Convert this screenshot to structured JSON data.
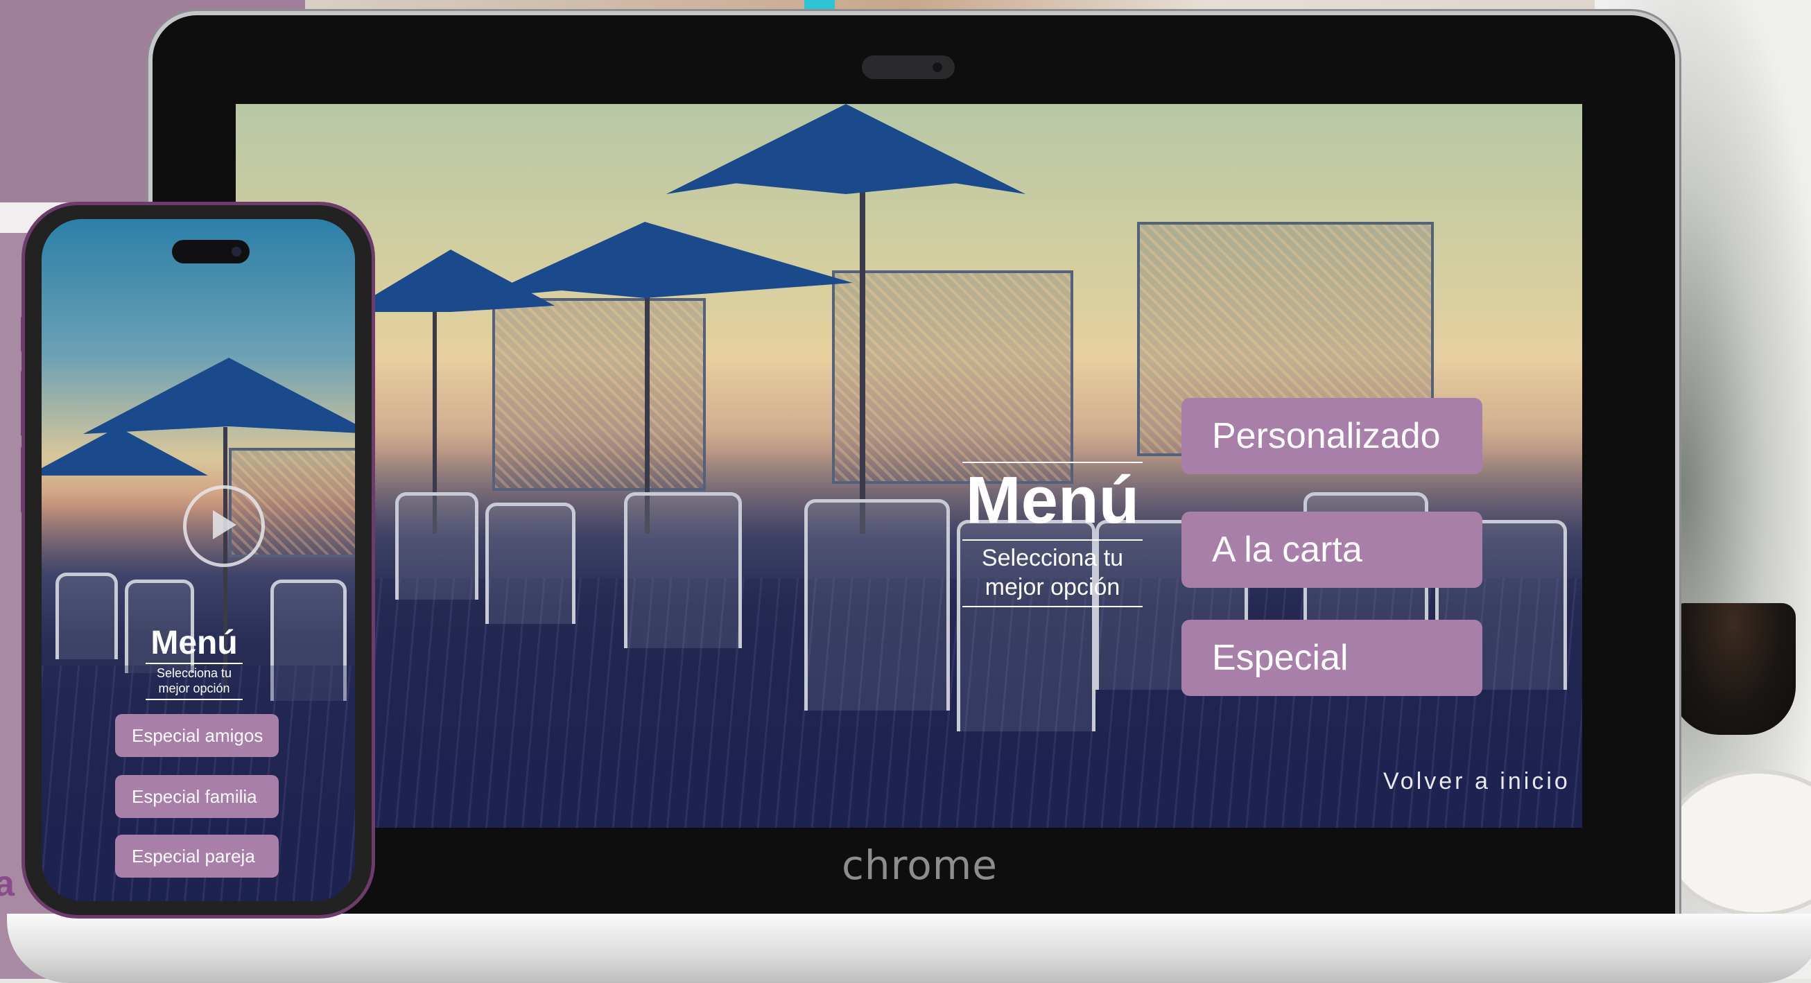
{
  "laptop": {
    "brand_label": "chrome",
    "menu": {
      "title": "Menú",
      "subtitle_line1": "Selecciona tu",
      "subtitle_line2": "mejor opción"
    },
    "options": [
      "Personalizado",
      "A la carta",
      "Especial"
    ],
    "back_link": "Volver a inicio"
  },
  "phone": {
    "menu": {
      "title": "Menú",
      "subtitle_line1": "Selecciona tu",
      "subtitle_line2": "mejor opción"
    },
    "options": [
      "Especial amigos",
      "Especial familia",
      "Especial pareja"
    ],
    "icons": [
      "play-icon"
    ]
  },
  "colors": {
    "button": "#a77fa8",
    "mauve_background": "#a98aa3",
    "accent": "#2fc3d3"
  }
}
